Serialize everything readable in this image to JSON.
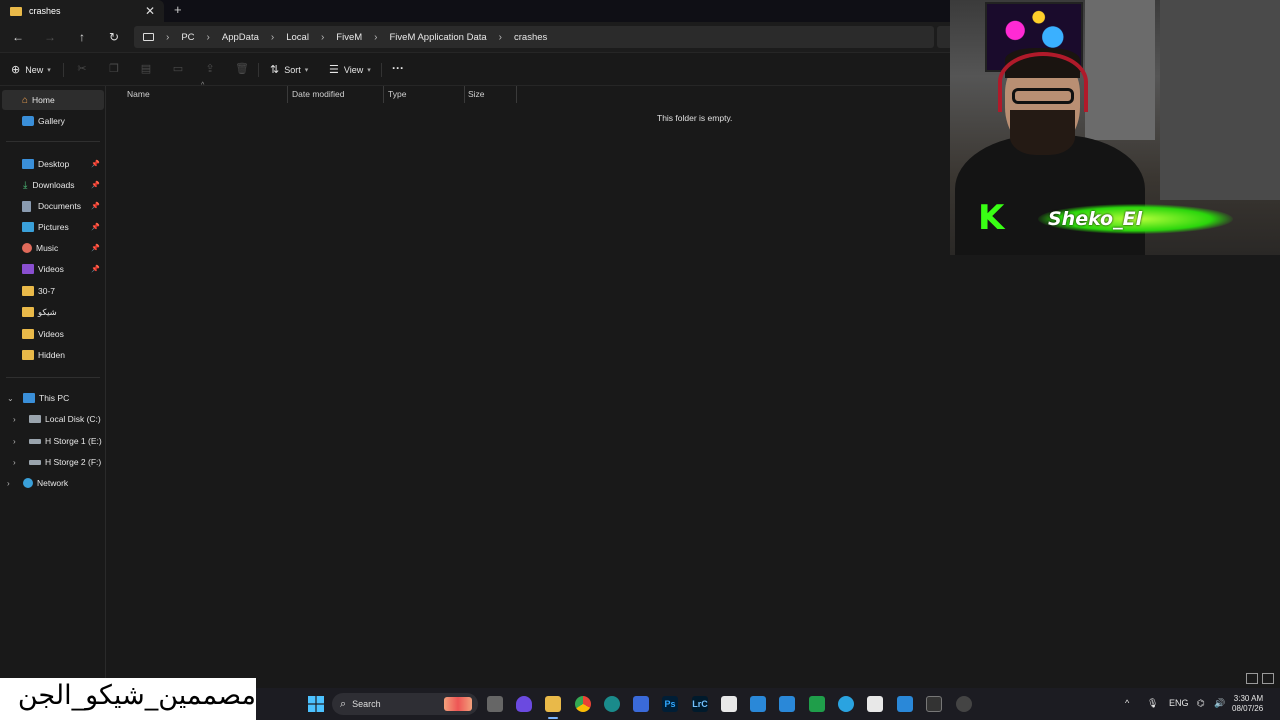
{
  "window": {
    "tab_title": "crashes",
    "tab_close": "✕",
    "new_tab": "+"
  },
  "nav": {
    "back": "←",
    "forward": "→",
    "up": "↑",
    "refresh": "↻"
  },
  "breadcrumbs": [
    "PC",
    "AppData",
    "Local",
    "FiveM",
    "FiveM Application Data",
    "crashes"
  ],
  "toolbar": {
    "new_label": "New",
    "sort_label": "Sort",
    "view_label": "View",
    "more": "···"
  },
  "sidebar": {
    "home": "Home",
    "gallery": "Gallery",
    "quick_access": [
      {
        "label": "Desktop",
        "icon": "desktop-icon",
        "pinned": true
      },
      {
        "label": "Downloads",
        "icon": "download-icon",
        "pinned": true
      },
      {
        "label": "Documents",
        "icon": "documents-icon",
        "pinned": true
      },
      {
        "label": "Pictures",
        "icon": "pictures-icon",
        "pinned": true
      },
      {
        "label": "Music",
        "icon": "music-icon",
        "pinned": true
      },
      {
        "label": "Videos",
        "icon": "videos-icon",
        "pinned": true
      },
      {
        "label": "30-7",
        "icon": "folder-icon",
        "pinned": false
      },
      {
        "label": "شيكو",
        "icon": "folder-icon",
        "pinned": false
      },
      {
        "label": "Videos",
        "icon": "folder-icon",
        "pinned": false
      },
      {
        "label": "Hidden",
        "icon": "folder-icon",
        "pinned": false
      }
    ],
    "this_pc": "This PC",
    "drives": [
      {
        "label": "Local Disk (C:)"
      },
      {
        "label": "H Storge 1 (E:)"
      },
      {
        "label": "H Storge 2 (F:)"
      }
    ],
    "network": "Network"
  },
  "columns": {
    "name": "Name",
    "date_modified": "Date modified",
    "type": "Type",
    "size": "Size"
  },
  "empty_message": "This folder is empty.",
  "webcam": {
    "overlay_letter": "K",
    "overlay_text": "Sheko_El"
  },
  "overlay_caption": "مصممين_شيكو_الجن",
  "taskbar": {
    "search_label": "Search",
    "language": "ENG",
    "time": "3:30 AM",
    "date": "08/07/26"
  },
  "colors": {
    "folder": "#e9b949",
    "accent": "#7ab4ff",
    "background": "#191919"
  }
}
